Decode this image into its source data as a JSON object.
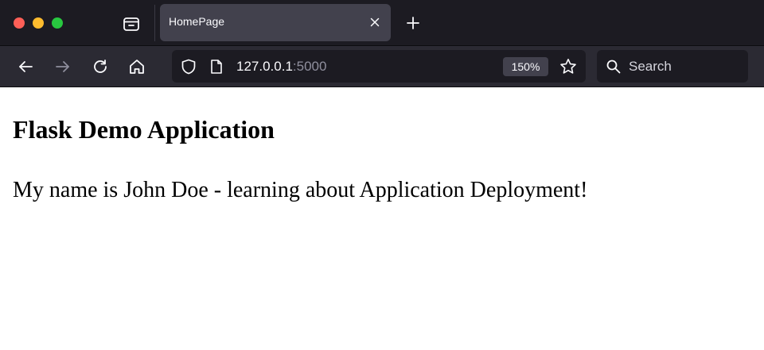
{
  "browser": {
    "window_controls": [
      "close",
      "minimize",
      "maximize"
    ],
    "tab": {
      "title": "HomePage",
      "close_icon": "close-icon"
    },
    "toolbar_icons": [
      "back-arrow-icon",
      "forward-arrow-icon",
      "reload-icon",
      "home-icon"
    ],
    "url": {
      "host": "127.0.0.1",
      "port": ":5000",
      "zoom": "150%"
    },
    "search": {
      "placeholder": "Search"
    },
    "colors": {
      "tabstrip": "#1c1b22",
      "toolbar": "#2b2a33",
      "active_tab": "#42414d",
      "traffic_red": "#fe5f57",
      "traffic_yellow": "#febc2e",
      "traffic_green": "#28c840"
    }
  },
  "page": {
    "heading": "Flask Demo Application",
    "paragraph": "My name is John Doe - learning about Application Deployment!"
  }
}
